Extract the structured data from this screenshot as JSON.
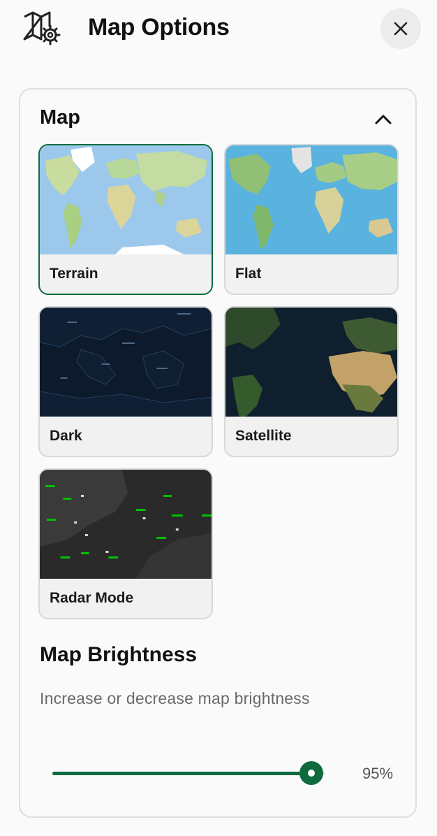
{
  "header": {
    "title": "Map Options",
    "icon": "map-settings-icon",
    "close_icon": "close-icon"
  },
  "map_section": {
    "title": "Map",
    "collapse_icon": "chevron-up-icon",
    "options": [
      {
        "label": "Terrain",
        "selected": true
      },
      {
        "label": "Flat",
        "selected": false
      },
      {
        "label": "Dark",
        "selected": false
      },
      {
        "label": "Satellite",
        "selected": false
      },
      {
        "label": "Radar Mode",
        "selected": false
      }
    ]
  },
  "brightness": {
    "title": "Map Brightness",
    "description": "Increase or decrease map brightness",
    "value": 95,
    "value_text": "95%"
  },
  "colors": {
    "accent": "#0f6b3e",
    "panel_border": "#dedede",
    "background": "#fafafa"
  }
}
